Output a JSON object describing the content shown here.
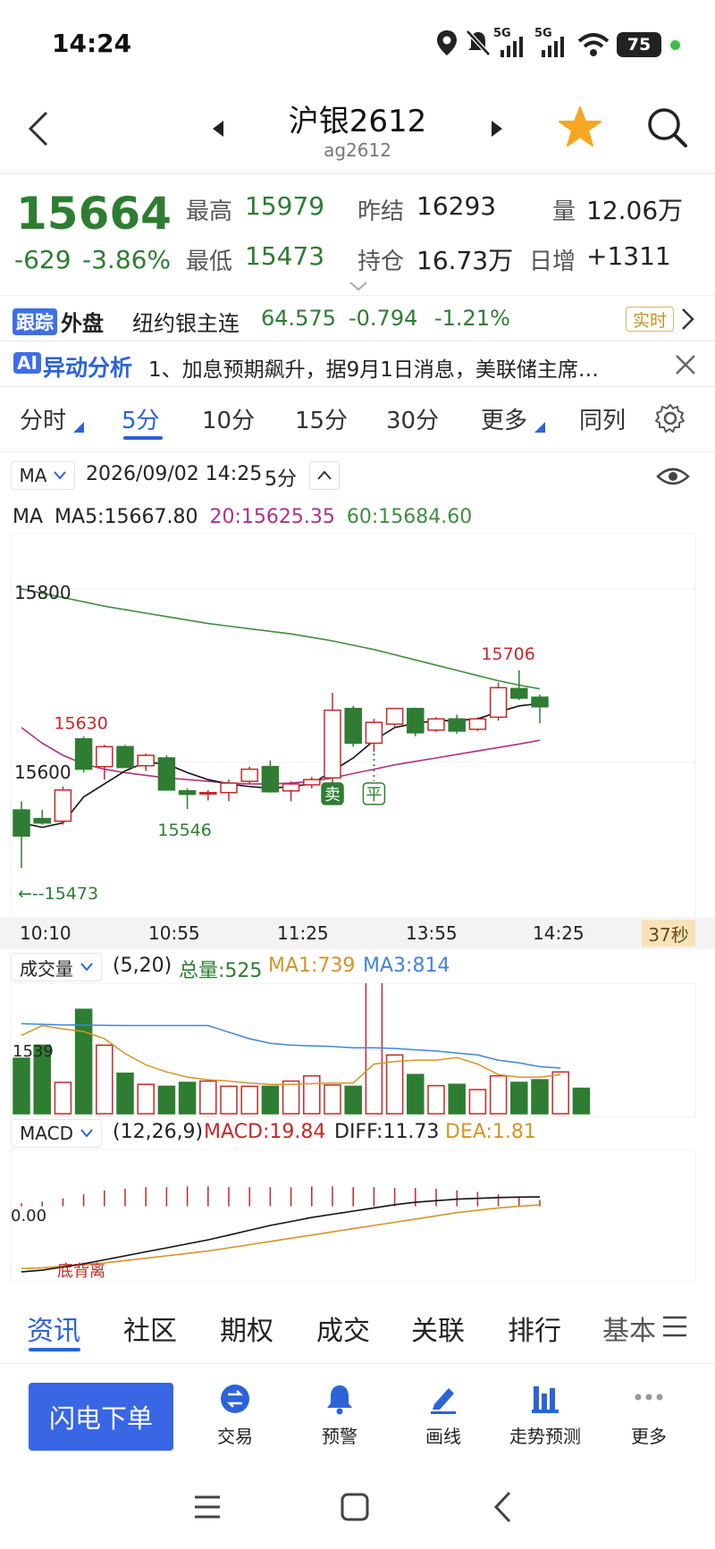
{
  "status_bar": {
    "time": "14:24",
    "signal_1": "5G",
    "signal_2": "5G",
    "battery": "75"
  },
  "header": {
    "title": "沪银2612",
    "subtitle": "ag2612"
  },
  "quote": {
    "price": "15664",
    "change": "-629",
    "change_pct": "-3.86%",
    "high_label": "最高",
    "high": "15979",
    "low_label": "最低",
    "low": "15473",
    "prev_settle_label": "昨结",
    "prev_settle": "16293",
    "open_interest_label": "持仓",
    "open_interest": "16.73万",
    "volume_label": "量",
    "volume": "12.06万",
    "daily_inc_label": "日增",
    "daily_inc": "+1311"
  },
  "foreign": {
    "tag1": "跟踪",
    "tag2": "外盘",
    "name": "纽约银主连",
    "price": "64.575",
    "change": "-0.794",
    "change_pct": "-1.21%",
    "realtime": "实时"
  },
  "ai_row": {
    "tag": "AI",
    "title": "异动分析",
    "text": "1、加息预期飙升，据9月1日消息，美联储主席…"
  },
  "period_tabs": [
    "分时",
    "5分",
    "10分",
    "15分",
    "30分",
    "更多",
    "同列"
  ],
  "chart_header": {
    "indicator": "MA",
    "datetime": "2026/09/02 14:25",
    "period": "5分",
    "ma_prefix": "MA",
    "ma5": "MA5:15667.80",
    "ma20": "20:15625.35",
    "ma60": "60:15684.60"
  },
  "time_axis": [
    "10:10",
    "10:55",
    "11:25",
    "13:55",
    "14:25"
  ],
  "countdown": "37秒",
  "volume_header": {
    "name": "成交量",
    "params": "(5,20)",
    "total": "总量:525",
    "ma1": "MA1:739",
    "ma3": "MA3:814",
    "axis_label": "1539"
  },
  "macd_header": {
    "name": "MACD",
    "params": "(12,26,9)",
    "macd": "MACD:19.84",
    "diff": "DIFF:11.73",
    "dea": "DEA:1.81",
    "axis_label": "0.00",
    "annotation": "底背离"
  },
  "bottom_tabs": [
    "资讯",
    "社区",
    "期权",
    "成交",
    "关联",
    "排行",
    "基本"
  ],
  "actions": {
    "order_button": "闪电下单",
    "items": [
      "交易",
      "预警",
      "画线",
      "走势预测",
      "更多"
    ]
  },
  "colors": {
    "up": "#c62828",
    "down": "#2e7d32",
    "accent": "#2b63d9",
    "ma5": "#111111",
    "ma20": "#b0308a",
    "ma60": "#3f8f3f",
    "vol_ma1": "#d4952a",
    "vol_ma3": "#3f86d9"
  },
  "chart_data": {
    "type": "candlestick",
    "title": "",
    "ylim": [
      15440,
      15840
    ],
    "y_ticks": [
      15800,
      15600
    ],
    "x_labels": [
      "10:10",
      "10:55",
      "11:25",
      "13:55",
      "14:25"
    ],
    "candles": [
      {
        "o": 15545,
        "h": 15555,
        "l": 15478,
        "c": 15515
      },
      {
        "o": 15535,
        "h": 15545,
        "l": 15528,
        "c": 15530
      },
      {
        "o": 15532,
        "h": 15572,
        "l": 15528,
        "c": 15568
      },
      {
        "o": 15627,
        "h": 15630,
        "l": 15588,
        "c": 15592
      },
      {
        "o": 15595,
        "h": 15620,
        "l": 15580,
        "c": 15618
      },
      {
        "o": 15618,
        "h": 15620,
        "l": 15595,
        "c": 15594
      },
      {
        "o": 15596,
        "h": 15610,
        "l": 15590,
        "c": 15608
      },
      {
        "o": 15605,
        "h": 15608,
        "l": 15570,
        "c": 15568
      },
      {
        "o": 15567,
        "h": 15570,
        "l": 15546,
        "c": 15563
      },
      {
        "o": 15564,
        "h": 15568,
        "l": 15556,
        "c": 15565
      },
      {
        "o": 15565,
        "h": 15580,
        "l": 15555,
        "c": 15576
      },
      {
        "o": 15578,
        "h": 15595,
        "l": 15575,
        "c": 15592
      },
      {
        "o": 15595,
        "h": 15602,
        "l": 15565,
        "c": 15566
      },
      {
        "o": 15567,
        "h": 15578,
        "l": 15555,
        "c": 15575
      },
      {
        "o": 15574,
        "h": 15583,
        "l": 15570,
        "c": 15580
      },
      {
        "o": 15582,
        "h": 15680,
        "l": 15578,
        "c": 15660
      },
      {
        "o": 15662,
        "h": 15665,
        "l": 15618,
        "c": 15622
      },
      {
        "o": 15622,
        "h": 15650,
        "l": 15612,
        "c": 15646
      },
      {
        "o": 15644,
        "h": 15662,
        "l": 15640,
        "c": 15662
      },
      {
        "o": 15662,
        "h": 15663,
        "l": 15630,
        "c": 15634
      },
      {
        "o": 15637,
        "h": 15652,
        "l": 15635,
        "c": 15650
      },
      {
        "o": 15650,
        "h": 15655,
        "l": 15633,
        "c": 15636
      },
      {
        "o": 15638,
        "h": 15652,
        "l": 15636,
        "c": 15650
      },
      {
        "o": 15652,
        "h": 15692,
        "l": 15648,
        "c": 15686
      },
      {
        "o": 15685,
        "h": 15706,
        "l": 15672,
        "c": 15674
      },
      {
        "o": 15675,
        "h": 15678,
        "l": 15645,
        "c": 15664
      }
    ],
    "ma5": [
      15530,
      15525,
      15530,
      15560,
      15575,
      15590,
      15600,
      15598,
      15588,
      15580,
      15575,
      15572,
      15570,
      15572,
      15575,
      15590,
      15605,
      15625,
      15640,
      15645,
      15648,
      15648,
      15650,
      15658,
      15665,
      15667.8
    ],
    "ma20": [
      15640,
      15622,
      15608,
      15598,
      15592,
      15588,
      15585,
      15582,
      15580,
      15578,
      15576,
      15575,
      15575,
      15576,
      15578,
      15582,
      15587,
      15592,
      15597,
      15601,
      15605,
      15609,
      15613,
      15617,
      15621,
      15625.35
    ],
    "ma60": [
      15800,
      15795,
      15790,
      15785,
      15780,
      15776,
      15772,
      15768,
      15764,
      15760,
      15757,
      15754,
      15751,
      15748,
      15744,
      15740,
      15735,
      15730,
      15724,
      15718,
      15712,
      15706,
      15700,
      15694,
      15689,
      15684.6
    ],
    "labels": {
      "high_mark": "15706",
      "mark_15630": "15630",
      "mark_15546": "15546",
      "mark_15473": "←--15473",
      "sell_marker": "卖",
      "close_marker": "平"
    },
    "volume": {
      "ylim": [
        0,
        2000
      ],
      "bars": [
        850,
        1050,
        480,
        1600,
        1050,
        620,
        450,
        420,
        480,
        500,
        420,
        420,
        420,
        500,
        580,
        440,
        420,
        2050,
        900,
        600,
        430,
        450,
        370,
        580,
        480,
        520,
        640,
        390
      ],
      "ma1": [
        1200,
        1350,
        1300,
        1260,
        1150,
        920,
        750,
        640,
        560,
        520,
        500,
        470,
        450,
        450,
        460,
        470,
        470,
        760,
        800,
        820,
        820,
        860,
        760,
        600,
        560,
        560,
        600,
        560
      ],
      "ma3": [
        1380,
        1370,
        1360,
        1360,
        1355,
        1350,
        1350,
        1350,
        1350,
        1350,
        1250,
        1150,
        1080,
        1050,
        1040,
        1030,
        1010,
        1010,
        1000,
        980,
        960,
        930,
        900,
        820,
        780,
        720,
        700,
        700
      ]
    },
    "macd": {
      "ylim": [
        -90,
        60
      ],
      "hist": [
        4,
        6,
        10,
        15,
        20,
        22,
        24,
        24,
        25,
        25,
        24,
        24,
        24,
        24,
        25,
        25,
        24,
        24,
        23,
        23,
        22,
        20,
        18,
        15,
        12,
        8
      ],
      "diff": [
        -82,
        -80,
        -76,
        -72,
        -67,
        -62,
        -57,
        -52,
        -47,
        -42,
        -36,
        -30,
        -24,
        -19,
        -14,
        -10,
        -6,
        -2,
        2,
        5,
        7,
        9,
        10,
        11,
        11.5,
        11.73
      ],
      "dea": [
        -78,
        -77,
        -75,
        -73,
        -71,
        -68,
        -65,
        -62,
        -59,
        -56,
        -52,
        -48,
        -44,
        -40,
        -36,
        -32,
        -28,
        -24,
        -20,
        -16,
        -12,
        -8,
        -5,
        -2,
        0,
        1.81
      ]
    }
  }
}
